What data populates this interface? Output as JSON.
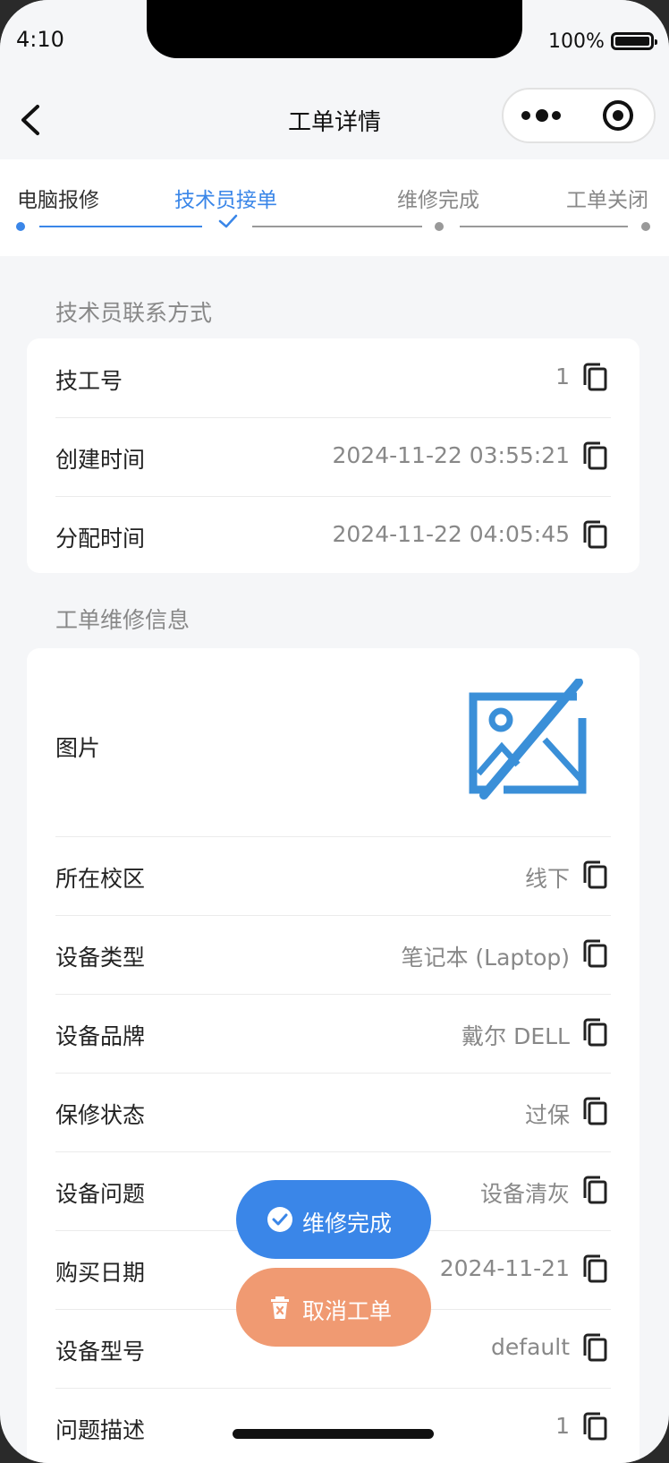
{
  "status_bar": {
    "time": "4:10",
    "battery": "100%"
  },
  "nav": {
    "title": "工单详情"
  },
  "steps": [
    {
      "label": "电脑报修"
    },
    {
      "label": "技术员接单"
    },
    {
      "label": "维修完成"
    },
    {
      "label": "工单关闭"
    }
  ],
  "tech_section": {
    "title": "技术员联系方式",
    "rows": [
      {
        "label": "技工号",
        "value": "1"
      },
      {
        "label": "创建时间",
        "value": "2024-11-22 03:55:21"
      },
      {
        "label": "分配时间",
        "value": "2024-11-22 04:05:45"
      }
    ]
  },
  "repair_section": {
    "title": "工单维修信息",
    "image_label": "图片",
    "rows": [
      {
        "label": "所在校区",
        "value": "线下"
      },
      {
        "label": "设备类型",
        "value": "笔记本 (Laptop)"
      },
      {
        "label": "设备品牌",
        "value": "戴尔 DELL"
      },
      {
        "label": "保修状态",
        "value": "过保"
      },
      {
        "label": "设备问题",
        "value": "设备清灰"
      },
      {
        "label": "购买日期",
        "value": "2024-11-21"
      },
      {
        "label": "设备型号",
        "value": "default"
      },
      {
        "label": "问题描述",
        "value": "1"
      }
    ]
  },
  "actions": {
    "complete_label": "维修完成",
    "cancel_label": "取消工单"
  },
  "colors": {
    "accent": "#3a86e8",
    "cancel": "#f09a72",
    "muted": "#888888"
  }
}
